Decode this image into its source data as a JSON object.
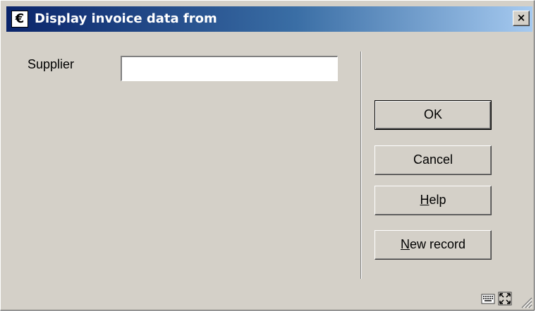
{
  "window": {
    "title": "Display invoice data from",
    "title_icon": "euro-icon",
    "close_label": "×"
  },
  "form": {
    "supplier_label": "Supplier",
    "supplier_value": "",
    "supplier_placeholder": ""
  },
  "buttons": {
    "ok": "OK",
    "cancel": "Cancel",
    "help_mnemonic": "H",
    "help_rest": "elp",
    "new_mnemonic": "N",
    "new_rest": "ew record"
  },
  "status_icons": [
    "keyboard-icon",
    "maximize-icon",
    "resize-grip-icon"
  ],
  "colors": {
    "dialog_bg": "#d4d0c8",
    "titlebar_start": "#0a246a",
    "titlebar_end": "#a6caf0",
    "title_text": "#ffffff"
  }
}
